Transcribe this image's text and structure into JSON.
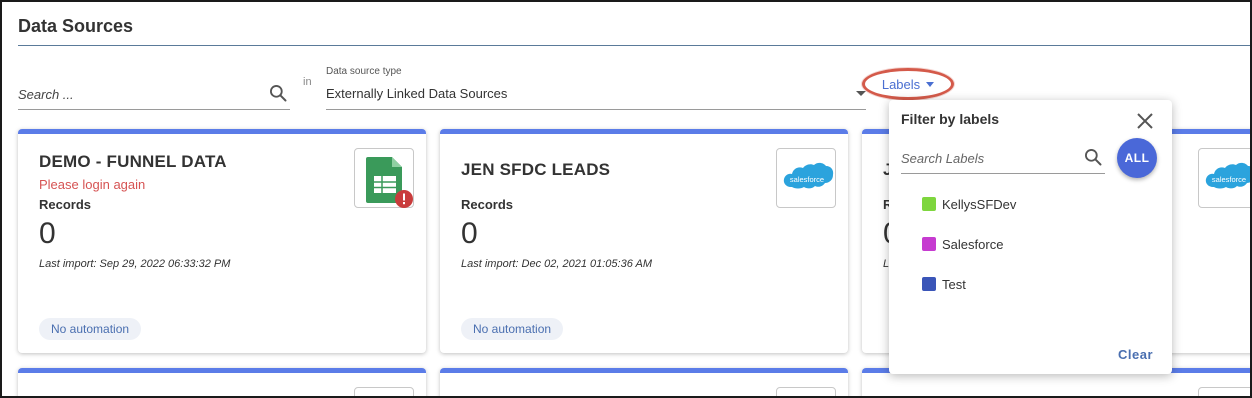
{
  "page": {
    "title": "Data Sources"
  },
  "filters": {
    "search_placeholder": "Search ...",
    "in_label": "in",
    "ds_type_label": "Data source type",
    "ds_type_value": "Externally Linked Data Sources",
    "labels_button": "Labels"
  },
  "cards": [
    {
      "title": "DEMO - FUNNEL DATA",
      "warning": "Please login again",
      "records_label": "Records",
      "count": "0",
      "last_import": "Last import: Sep 29, 2022 06:33:32 PM",
      "automation": "No automation",
      "icon": "google-sheets-icon"
    },
    {
      "title": "JEN SFDC LEADS",
      "warning": "",
      "records_label": "Records",
      "count": "0",
      "last_import": "Last import: Dec 02, 2021 01:05:36 AM",
      "automation": "No automation",
      "icon": "salesforce-icon"
    },
    {
      "title": "J",
      "records_label": "R",
      "count": "0",
      "last_import": "L",
      "icon": "salesforce-icon"
    }
  ],
  "labels_popup": {
    "title": "Filter by labels",
    "search_placeholder": "Search Labels",
    "all_button": "ALL",
    "items": [
      {
        "label": "KellysSFDev",
        "color": "#7ed63e"
      },
      {
        "label": "Salesforce",
        "color": "#c63bd0"
      },
      {
        "label": "Test",
        "color": "#3a55b8"
      }
    ],
    "clear_button": "Clear"
  },
  "colors": {
    "accent": "#5b7ce8",
    "link": "#4a6fd1",
    "warning": "#d65353",
    "highlight_ring": "#d45a4a"
  }
}
